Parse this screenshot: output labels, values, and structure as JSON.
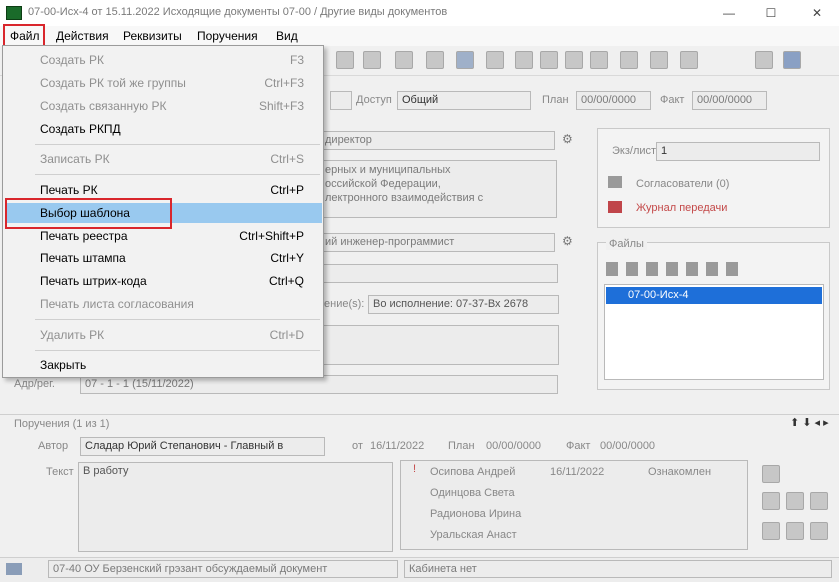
{
  "window": {
    "title": "07-00-Исх-4 от 15.11.2022 Исходящие документы 07-00 / Другие виды документов",
    "buttons": [
      "—",
      "☐",
      "✕"
    ]
  },
  "menubar": {
    "items": [
      "Файл",
      "Действия",
      "Реквизиты",
      "Поручения",
      "Вид"
    ]
  },
  "file_menu": {
    "items": [
      {
        "label": "Создать РК",
        "shortcut": "F3",
        "disabled": true
      },
      {
        "label": "Создать РК той же группы",
        "shortcut": "Ctrl+F3",
        "disabled": true
      },
      {
        "label": "Создать связанную РК",
        "shortcut": "Shift+F3",
        "disabled": true
      },
      {
        "label": "Создать РКПД",
        "shortcut": "",
        "disabled": false
      },
      {
        "label": "Записать РК",
        "shortcut": "Ctrl+S",
        "disabled": true
      },
      {
        "label": "Печать РК",
        "shortcut": "Ctrl+P",
        "disabled": false
      },
      {
        "label": "Выбор шаблона",
        "shortcut": "",
        "disabled": false,
        "selected": true
      },
      {
        "label": "Печать реестра",
        "shortcut": "Ctrl+Shift+P",
        "disabled": false
      },
      {
        "label": "Печать штампа",
        "shortcut": "Ctrl+Y",
        "disabled": false
      },
      {
        "label": "Печать штрих-кода",
        "shortcut": "Ctrl+Q",
        "disabled": false
      },
      {
        "label": "Печать листа согласования",
        "shortcut": "",
        "disabled": true
      },
      {
        "label": "Удалить РК",
        "shortcut": "Ctrl+D",
        "disabled": true
      },
      {
        "label": "Закрыть",
        "shortcut": "",
        "disabled": false
      }
    ]
  },
  "header_fields": {
    "access_label": "Доступ",
    "access_value": "Общий",
    "plan_label": "План",
    "plan_value": "00/00/0000",
    "fact_label": "Факт",
    "fact_value": "00/00/0000"
  },
  "card": {
    "signer": "директор",
    "summary_lines": [
      "ерных и муниципальных",
      "оссийской Федерации,",
      "лектронного взаимодействия с"
    ],
    "executor": "ий инженер-программист",
    "link_value": "Во исполнение: 07-37-Вх 2678",
    "link_label": "ение(s):",
    "reg_label": "Адр/рег.",
    "reg_value": "07 - 1 - 1 (15/11/2022)"
  },
  "right_panel": {
    "copies_label": "Экз/лист",
    "copies_value": "1",
    "approvals": "Согласователи (0)",
    "journal": "Журнал передачи",
    "files_header": "Файлы",
    "file_item": "07-00-Исх-4"
  },
  "assignments": {
    "header": "Поручения (1 из 1)",
    "author_label": "Автор",
    "author_value": "Сладар Юрий Степанович - Главный в",
    "date_label": "от",
    "date_value": "16/11/2022",
    "plan_label": "План",
    "plan_value": "00/00/0000",
    "fact_label": "Факт",
    "fact_value": "00/00/0000",
    "text_label": "Текст",
    "text_value": "В работу",
    "executors": [
      {
        "name": "Осипова Андрей",
        "date": "16/11/2022",
        "status": "Ознакомлен"
      },
      {
        "name": "Одинцова Света",
        "date": "",
        "status": ""
      },
      {
        "name": "Радионова Ирина",
        "date": "",
        "status": ""
      },
      {
        "name": "Уральская Анаст",
        "date": "",
        "status": ""
      }
    ]
  },
  "status": {
    "left": "07-40 ОУ Берзенский грэзант обсуждаемый документ",
    "right": "Кабинета нет"
  }
}
